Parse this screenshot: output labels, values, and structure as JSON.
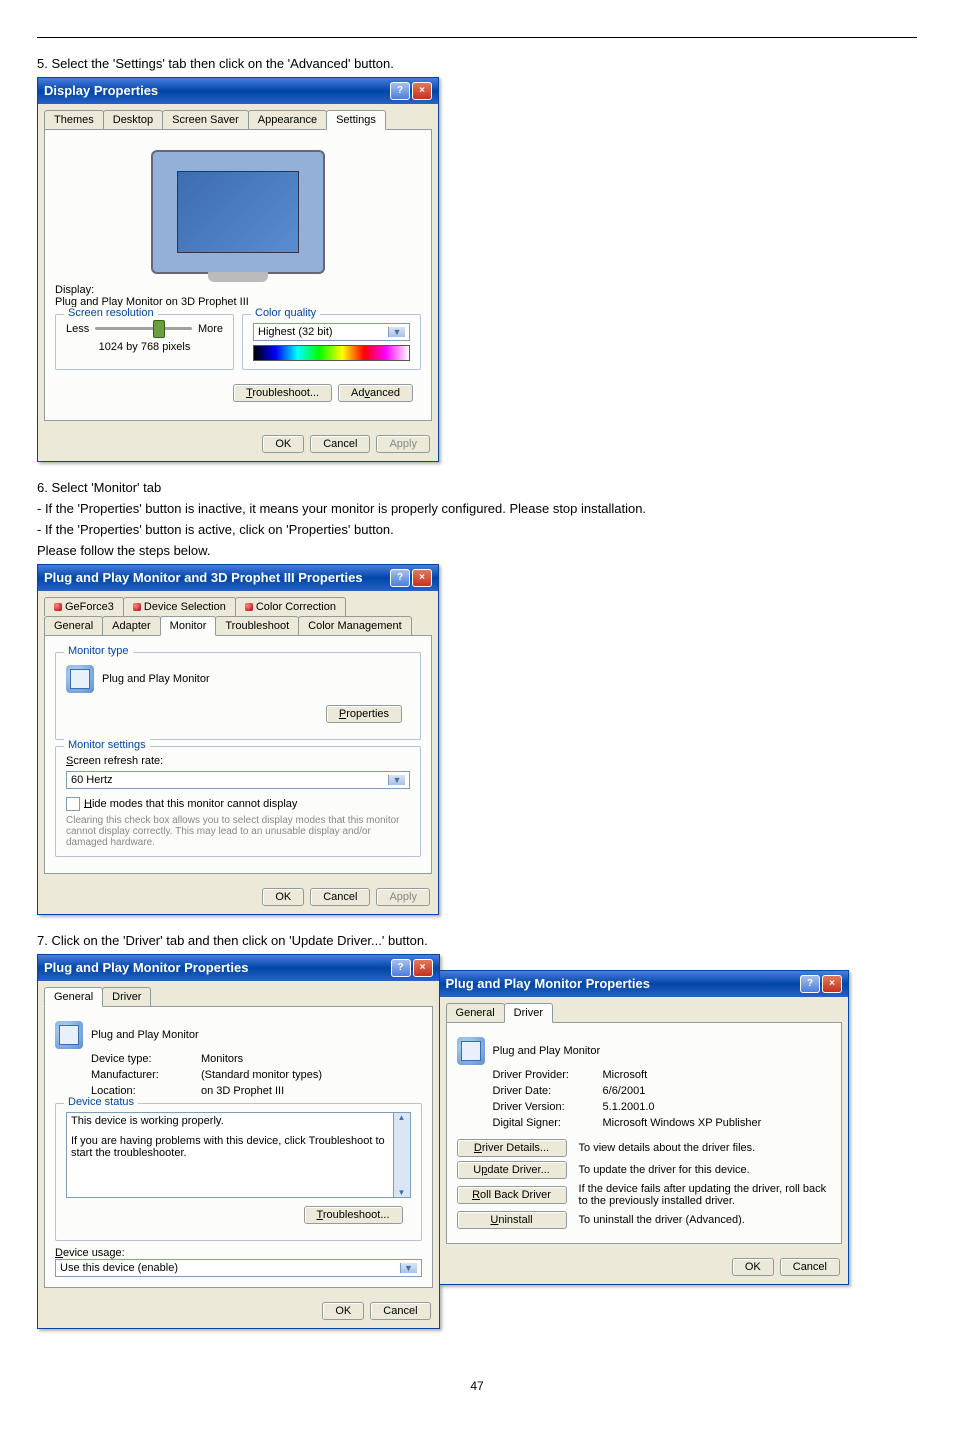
{
  "step5": "5. Select the 'Settings' tab then click on the 'Advanced' button.",
  "dlg1": {
    "title": "Display Properties",
    "tabs": [
      "Themes",
      "Desktop",
      "Screen Saver",
      "Appearance",
      "Settings"
    ],
    "display_label": "Display:",
    "display_value": "Plug and Play Monitor on 3D Prophet III",
    "resolution": {
      "legend": "Screen resolution",
      "less": "Less",
      "more": "More",
      "value": "1024 by 768 pixels"
    },
    "color": {
      "legend": "Color quality",
      "value": "Highest (32 bit)"
    },
    "troubleshoot": "Troubleshoot...",
    "advanced": "Advanced",
    "ok": "OK",
    "cancel": "Cancel",
    "apply": "Apply"
  },
  "step6": "6. Select 'Monitor' tab",
  "step6a": "- If the 'Properties' button is inactive, it means your monitor is properly configured. Please stop installation.",
  "step6b": "- If the 'Properties' button is active, click on 'Properties' button.",
  "step6c": "Please follow the steps below.",
  "dlg2": {
    "title": "Plug and Play Monitor and 3D Prophet III Properties",
    "tabs1": [
      "GeForce3",
      "Device Selection",
      "Color Correction"
    ],
    "tabs2": [
      "General",
      "Adapter",
      "Monitor",
      "Troubleshoot",
      "Color Management"
    ],
    "montype": {
      "legend": "Monitor type",
      "name": "Plug and Play Monitor",
      "properties": "Properties"
    },
    "monset": {
      "legend": "Monitor settings",
      "refresh": "Screen refresh rate:",
      "hz": "60 Hertz",
      "hide": "Hide modes that this monitor cannot display",
      "note": "Clearing this check box allows you to select display modes that this monitor cannot display correctly. This may lead to an unusable display and/or damaged hardware."
    },
    "ok": "OK",
    "cancel": "Cancel",
    "apply": "Apply"
  },
  "step7": "7. Click on the 'Driver' tab and then click on 'Update Driver...' button.",
  "dlg3": {
    "title": "Plug and Play Monitor Properties",
    "tabs": [
      "General",
      "Driver"
    ],
    "name": "Plug and Play Monitor",
    "type_l": "Device type:",
    "type_v": "Monitors",
    "manu_l": "Manufacturer:",
    "manu_v": "(Standard monitor types)",
    "loc_l": "Location:",
    "loc_v": "on 3D Prophet III",
    "status_legend": "Device status",
    "status_text": "This device is working properly.",
    "status_help": "If you are having problems with this device, click Troubleshoot to start the troubleshooter.",
    "troubleshoot": "Troubleshoot...",
    "usage_l": "Device usage:",
    "usage_v": "Use this device (enable)",
    "ok": "OK",
    "cancel": "Cancel"
  },
  "dlg4": {
    "title": "Plug and Play Monitor Properties",
    "tabs": [
      "General",
      "Driver"
    ],
    "name": "Plug and Play Monitor",
    "prov_l": "Driver Provider:",
    "prov_v": "Microsoft",
    "date_l": "Driver Date:",
    "date_v": "6/6/2001",
    "ver_l": "Driver Version:",
    "ver_v": "5.1.2001.0",
    "sign_l": "Digital Signer:",
    "sign_v": "Microsoft Windows XP Publisher",
    "details_b": "Driver Details...",
    "details_t": "To view details about the driver files.",
    "update_b": "Update Driver...",
    "update_t": "To update the driver for this device.",
    "roll_b": "Roll Back Driver",
    "roll_t": "If the device fails after updating the driver, roll back to the previously installed driver.",
    "unin_b": "Uninstall",
    "unin_t": "To uninstall the driver (Advanced).",
    "ok": "OK",
    "cancel": "Cancel"
  },
  "pagenum": "47"
}
